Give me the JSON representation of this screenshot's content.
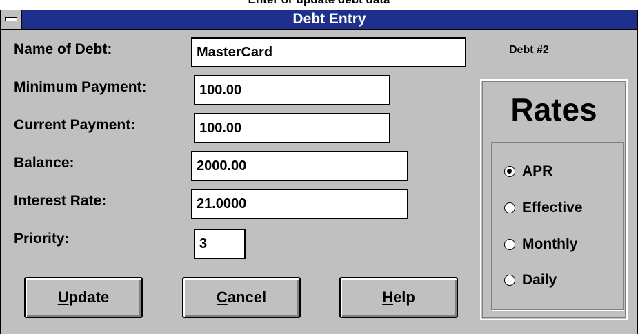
{
  "window": {
    "title": "Debt Entry",
    "cropped_heading": "Enter or update debt data"
  },
  "form": {
    "name_label": "Name of Debt:",
    "name_value": "MasterCard",
    "min_payment_label": "Minimum Payment:",
    "min_payment_value": "100.00",
    "current_payment_label": "Current Payment:",
    "current_payment_value": "100.00",
    "balance_label": "Balance:",
    "balance_value": "2000.00",
    "interest_label": "Interest Rate:",
    "interest_value": "21.0000",
    "priority_label": "Priority:",
    "priority_value": "3"
  },
  "debt_number": "Debt #2",
  "rates": {
    "title": "Rates",
    "options": [
      "APR",
      "Effective",
      "Monthly",
      "Daily"
    ],
    "selected": "APR"
  },
  "buttons": {
    "update_mnemonic": "U",
    "update_rest": "pdate",
    "cancel_mnemonic": "C",
    "cancel_rest": "ancel",
    "help_mnemonic": "H",
    "help_rest": "elp"
  },
  "colors": {
    "titlebar": "#1f2f8c",
    "face": "#c0c0c0"
  }
}
